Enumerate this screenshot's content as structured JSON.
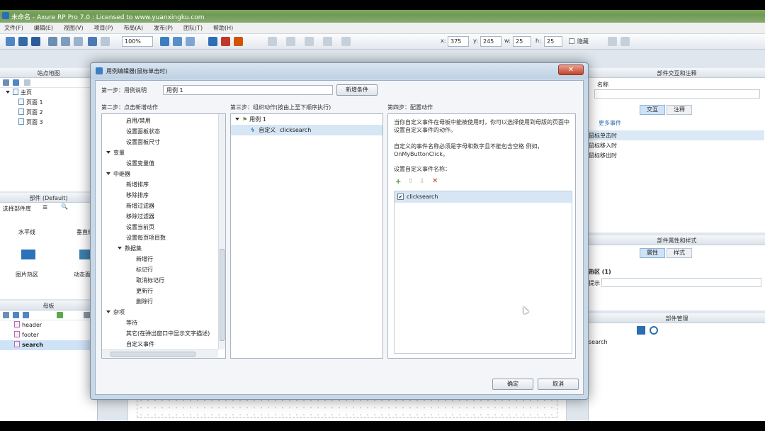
{
  "app": {
    "title": "未命名 - Axure RP Pro 7.0 : Licensed to www.yuanxingku.com",
    "menu": [
      "文件(F)",
      "编辑(E)",
      "视图(V)",
      "项目(P)",
      "布局(A)",
      "发布(P)",
      "团队(T)",
      "帮助(H)"
    ],
    "zoom": "100%",
    "x_label": "x:",
    "x_value": "375",
    "y_label": "y:",
    "y_value": "245",
    "w_label": "w:",
    "w_value": "25",
    "h_label": "h:",
    "h_value": "25",
    "hidden_label": "隐藏"
  },
  "sitemap": {
    "title": "站点地图",
    "root": "主页",
    "pages": [
      "页面 1",
      "页面 2",
      "页面 3"
    ]
  },
  "widgets": {
    "title": "部件 (Default)",
    "library": "选择部件库",
    "items": [
      "水平线",
      "垂直线",
      "图片热区",
      "动态面板"
    ]
  },
  "masters": {
    "title": "母板",
    "items": [
      "header",
      "footer",
      "search"
    ]
  },
  "right": {
    "interaction_title": "部件交互和注释",
    "name_label": "名称",
    "tab_interact": "交互",
    "tab_notes": "注释",
    "more": "更多事件",
    "events": [
      "鼠标单击时",
      "鼠标移入时",
      "鼠标移出时"
    ],
    "style_title": "部件属性和样式",
    "tab_props": "属性",
    "tab_style": "样式",
    "hotspot": "热区 (1)",
    "tooltip_label": "提示",
    "manager_title": "部件管理",
    "search_text": "search"
  },
  "dialog": {
    "title": "用例编辑器(鼠标单击时)",
    "close": "✕",
    "step1": "第一步：用例说明",
    "case_name": "用例 1",
    "add_condition": "新增条件",
    "step2": "第二步：点击新增动作",
    "step3": "第三步：组织动作(按由上至下顺序执行)",
    "step4": "第四步：配置动作",
    "actions": [
      {
        "text": "启用/禁用",
        "level": 1
      },
      {
        "text": "设置面板状态",
        "level": 1
      },
      {
        "text": "设置面板尺寸",
        "level": 1
      },
      {
        "text": "变量",
        "level": 0
      },
      {
        "text": "设置变量值",
        "level": 1
      },
      {
        "text": "中继器",
        "level": 0
      },
      {
        "text": "新增排序",
        "level": 1
      },
      {
        "text": "移除排序",
        "level": 1
      },
      {
        "text": "新增过滤器",
        "level": 1
      },
      {
        "text": "移除过滤器",
        "level": 1
      },
      {
        "text": "设置当前页",
        "level": 1
      },
      {
        "text": "设置每页项目数",
        "level": 1
      },
      {
        "text": "数据集",
        "level": 1,
        "group": true
      },
      {
        "text": "新增行",
        "level": 2
      },
      {
        "text": "标记行",
        "level": 2
      },
      {
        "text": "取消标记行",
        "level": 2
      },
      {
        "text": "更新行",
        "level": 2
      },
      {
        "text": "删除行",
        "level": 2
      },
      {
        "text": "杂项",
        "level": 0
      },
      {
        "text": "等待",
        "level": 1
      },
      {
        "text": "其它(在弹出窗口中显示文字描述)",
        "level": 1
      },
      {
        "text": "自定义事件",
        "level": 1
      }
    ],
    "org_case": "用例 1",
    "org_action_prefix": "自定义",
    "org_action_name": "clicksearch",
    "config_desc1": "当你自定义事件在母板中能被使用时，你可以选择使用到母版的页面中设置自定义事件的动作。",
    "config_desc2": "自定义的事件名称必须是字母和数字且不能包含空格 例如，OnMyButtonClick。",
    "config_list_label": "设置自定义事件名称：",
    "custom_event": "clicksearch",
    "ok": "确定",
    "cancel": "取消"
  },
  "colors": {
    "accent": "#d7e6f5",
    "selection": "#dbe9f6"
  }
}
